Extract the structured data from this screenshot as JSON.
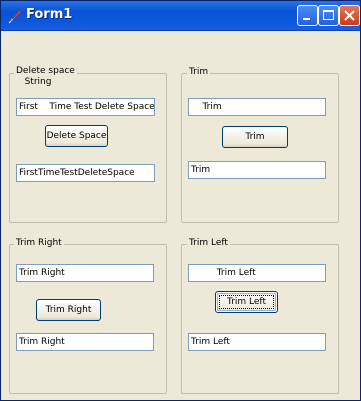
{
  "window": {
    "title": "Form1"
  },
  "groups": {
    "delete_space": {
      "title": "Delete space\n   String",
      "input_value": "First    Time Test Delete Space",
      "button_label": "Delete Space",
      "output_value": "FirstTimeTestDeleteSpace"
    },
    "trim": {
      "title": "Trim",
      "input_value": "    Trim",
      "button_label": "Trim",
      "output_value": "Trim"
    },
    "trim_right": {
      "title": "Trim Right",
      "input_value": "Trim Right",
      "button_label": "Trim Right",
      "output_value": "Trim Right"
    },
    "trim_left": {
      "title": "Trim Left",
      "input_value": "         Trim Left",
      "button_label": "Trim Left",
      "output_value": "Trim Left"
    }
  },
  "icons": {
    "app": "feather-icon",
    "minimize": "minimize-icon",
    "maximize": "maximize-icon",
    "close": "close-icon"
  }
}
